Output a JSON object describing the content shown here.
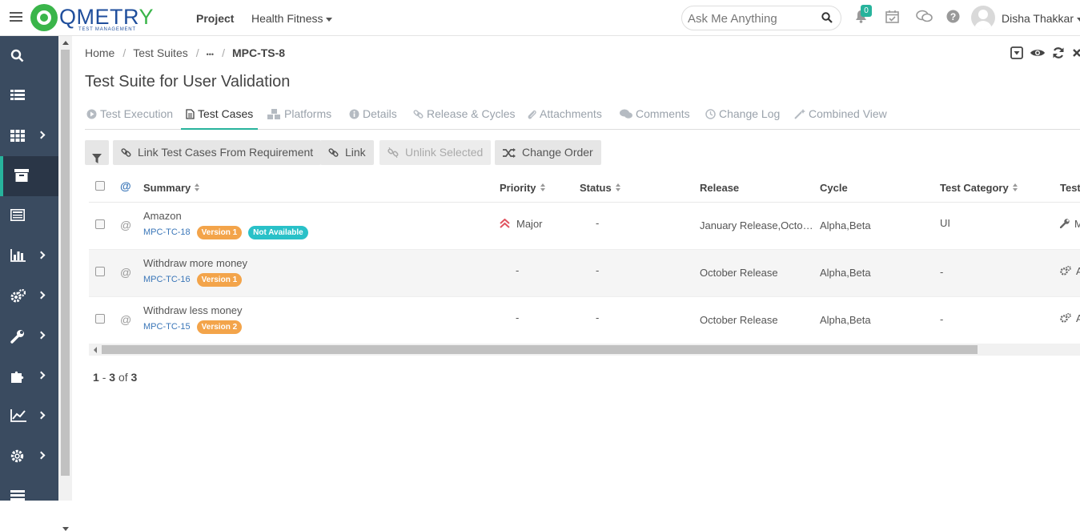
{
  "header": {
    "logo_text": "QMETRY",
    "logo_subtext": "TEST MANAGEMENT",
    "project_label": "Project",
    "project_name": "Health Fitness",
    "search_placeholder": "Ask Me Anything",
    "notification_count": "0",
    "user_name": "Disha Thakkar"
  },
  "breadcrumb": {
    "home": "Home",
    "test_suites": "Test Suites",
    "ellipsis": "•••",
    "current": "MPC-TS-8"
  },
  "page_title": "Test Suite for User Validation",
  "tabs": [
    {
      "label": "Test Execution",
      "icon": "play-circle-icon"
    },
    {
      "label": "Test Cases",
      "icon": "file-icon"
    },
    {
      "label": "Platforms",
      "icon": "cubes-icon"
    },
    {
      "label": "Details",
      "icon": "info-circle-icon"
    },
    {
      "label": "Release & Cycles",
      "icon": "link-icon"
    },
    {
      "label": "Attachments",
      "icon": "paperclip-icon"
    },
    {
      "label": "Comments",
      "icon": "comments-icon"
    },
    {
      "label": "Change Log",
      "icon": "clock-icon"
    },
    {
      "label": "Combined View",
      "icon": "magic-icon"
    }
  ],
  "toolbar": {
    "link_from_req": "Link Test Cases From Requirement",
    "link": "Link",
    "unlink": "Unlink Selected",
    "change_order": "Change Order"
  },
  "table": {
    "columns": [
      "Summary",
      "Priority",
      "Status",
      "Release",
      "Cycle",
      "Test Category",
      "Test"
    ],
    "rows": [
      {
        "summary": "Amazon",
        "key": "MPC-TC-18",
        "version": "Version 1",
        "extra_badge": "Not Available",
        "priority": "Major",
        "status": "-",
        "release": "January Release,Octo…",
        "cycle": "Alpha,Beta",
        "category": "UI",
        "test_type_icon": "wrench-icon",
        "test_type": "M"
      },
      {
        "summary": "Withdraw more money",
        "key": "MPC-TC-16",
        "version": "Version 1",
        "priority": "-",
        "status": "-",
        "release": "October Release",
        "cycle": "Alpha,Beta",
        "category": "-",
        "test_type_icon": "gears-icon",
        "test_type": "A"
      },
      {
        "summary": "Withdraw less money",
        "key": "MPC-TC-15",
        "version": "Version 2",
        "priority": "-",
        "status": "-",
        "release": "October Release",
        "cycle": "Alpha,Beta",
        "category": "-",
        "test_type_icon": "gears-icon",
        "test_type": "A"
      }
    ]
  },
  "pager": {
    "from": "1",
    "dash": "-",
    "to": "3",
    "of": "of",
    "total": "3"
  },
  "colors": {
    "sidebar": "#3a4b60",
    "accent": "#27b39c",
    "badge_orange": "#f3a44a",
    "badge_teal": "#29c1c8",
    "priority_major": "#e0535f"
  }
}
